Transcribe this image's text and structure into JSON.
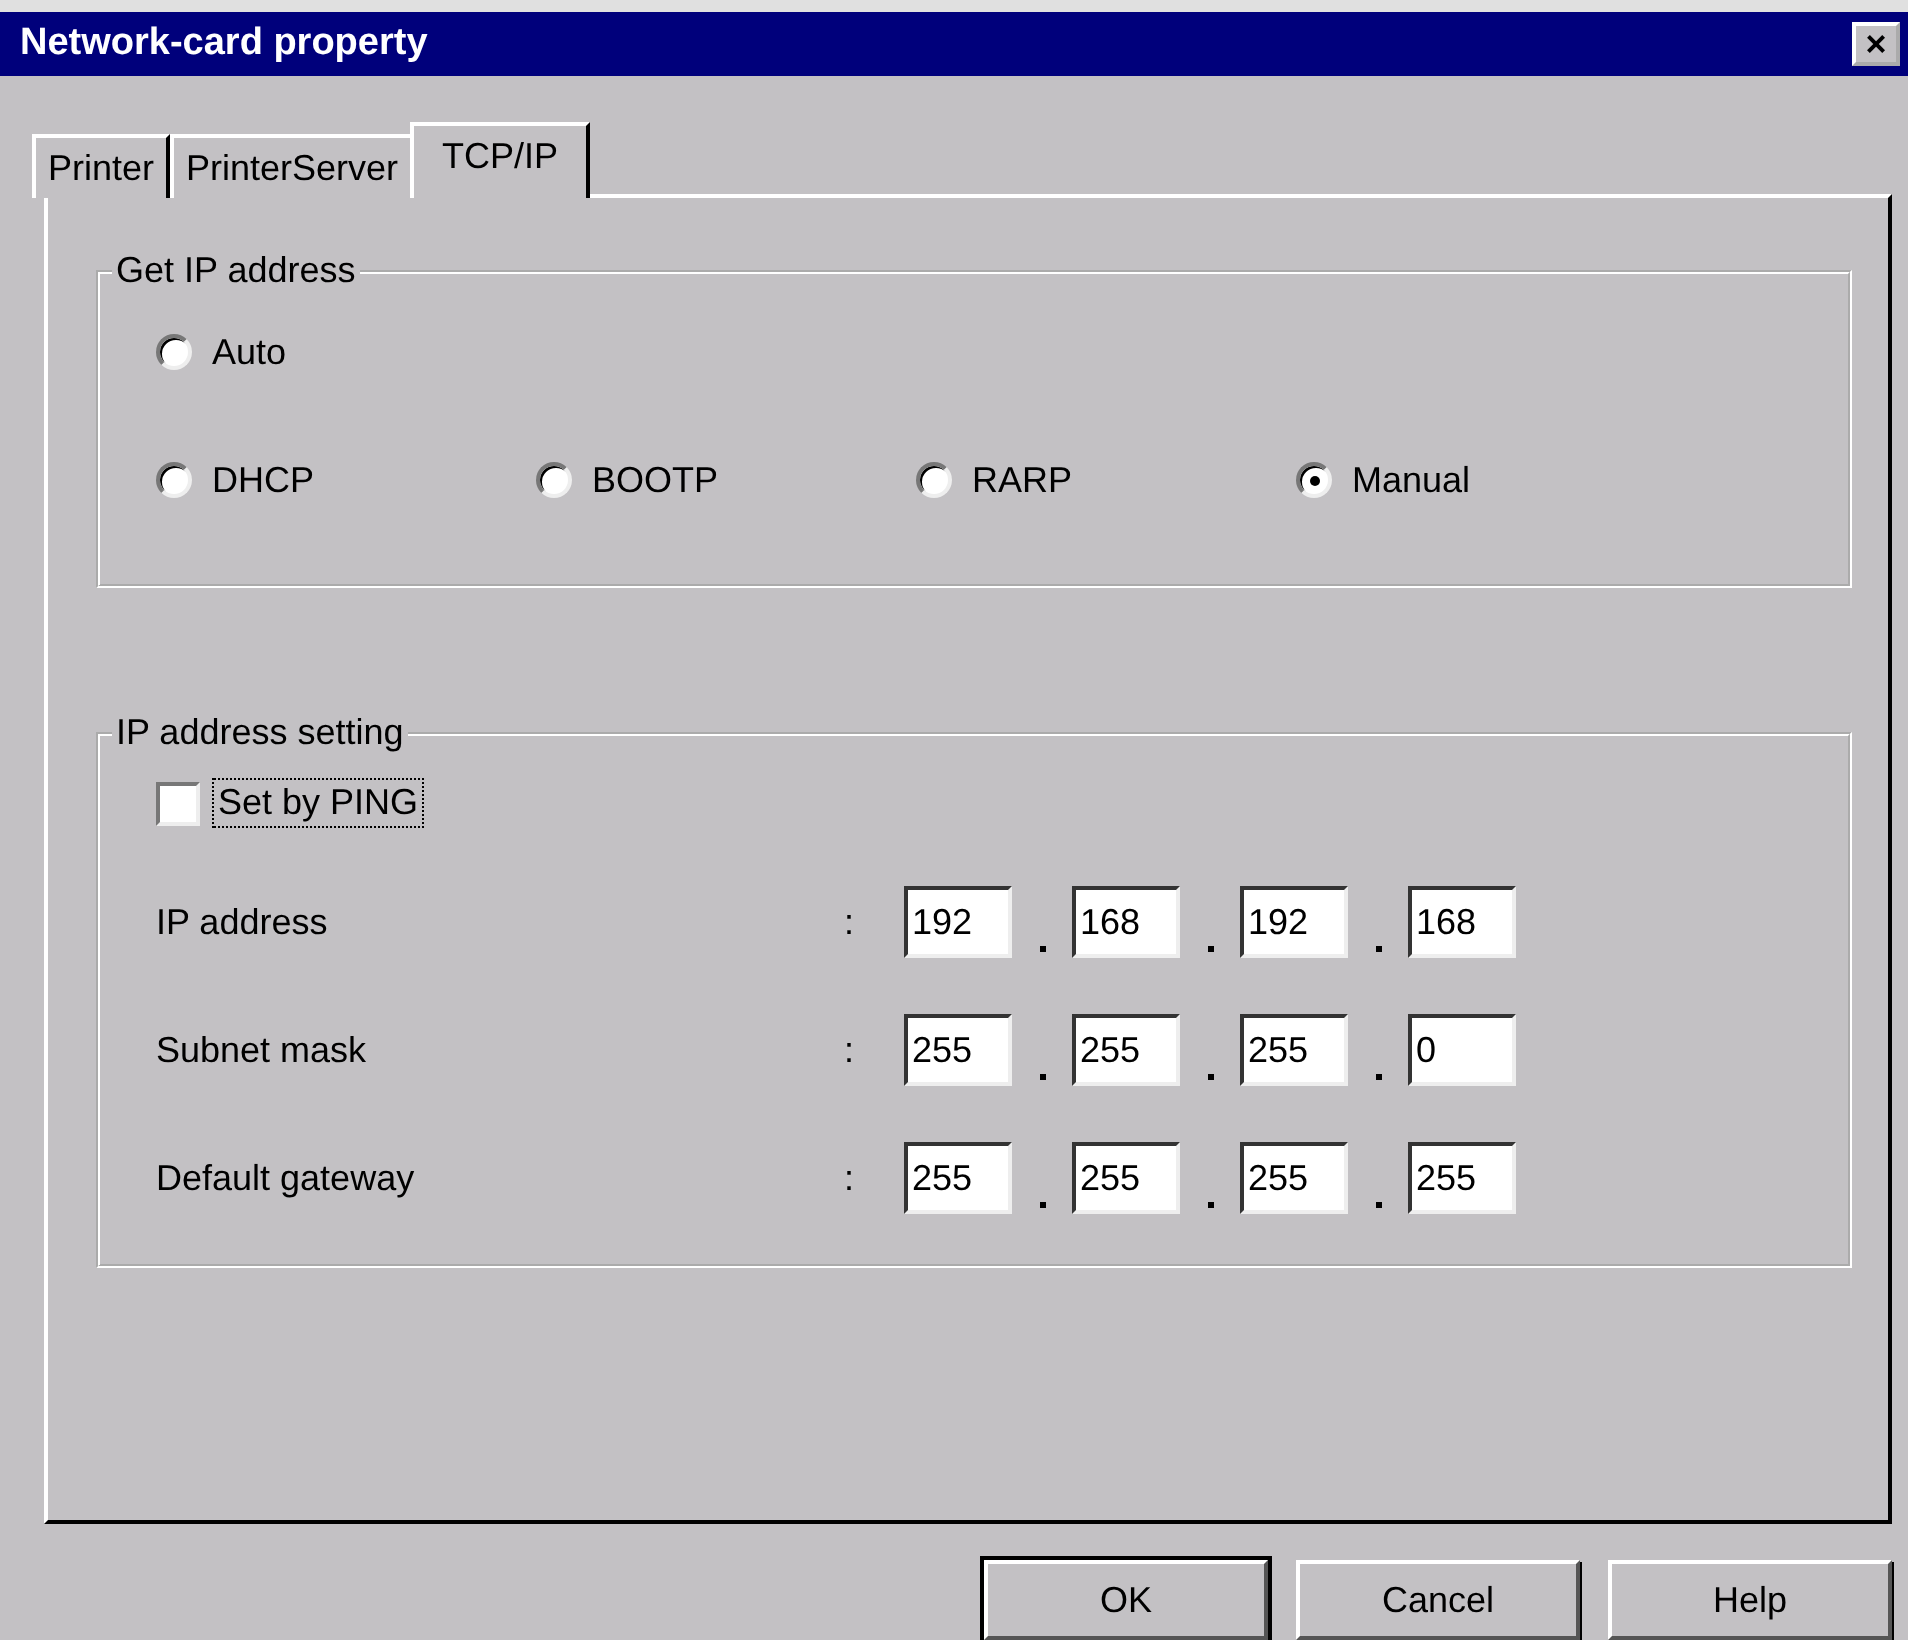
{
  "window": {
    "title": "Network-card property",
    "close": "×"
  },
  "tabs": [
    {
      "label": "Printer",
      "selected": false
    },
    {
      "label": "PrinterServer",
      "selected": false
    },
    {
      "label": "TCP/IP",
      "selected": true
    }
  ],
  "get_ip_group": {
    "title": "Get IP address",
    "option_rows": [
      [
        {
          "label": "Auto",
          "selected": false
        }
      ],
      [
        {
          "label": "DHCP",
          "selected": false
        },
        {
          "label": "BOOTP",
          "selected": false
        },
        {
          "label": "RARP",
          "selected": false
        },
        {
          "label": "Manual",
          "selected": true
        }
      ]
    ]
  },
  "ip_setting_group": {
    "title": "IP address setting",
    "set_by_ping": {
      "label": "Set by PING",
      "checked": false
    },
    "fields": [
      {
        "label": "IP address",
        "colon": ":",
        "octets": [
          "192",
          "168",
          "192",
          "168"
        ]
      },
      {
        "label": "Subnet mask",
        "colon": ":",
        "octets": [
          "255",
          "255",
          "255",
          "0"
        ]
      },
      {
        "label": "Default gateway",
        "colon": ":",
        "octets": [
          "255",
          "255",
          "255",
          "255"
        ]
      }
    ]
  },
  "buttons": [
    {
      "label": "OK",
      "default": true
    },
    {
      "label": "Cancel",
      "default": false
    },
    {
      "label": "Help",
      "default": false
    }
  ]
}
